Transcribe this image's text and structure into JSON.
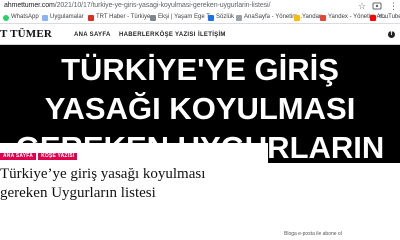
{
  "browser": {
    "url_host": "ahmettumer.com",
    "url_path": "/2021/10/17/turkiye-ye-giris-yasagi-koyulmasi-gereken-uygurlarin-listesi/",
    "bookmarks": [
      {
        "label": "WhatsApp",
        "color": "#25d366"
      },
      {
        "label": "Uygulamalar",
        "color": "#8ab4f8"
      },
      {
        "label": "TRT Haber - Türkiye...",
        "color": "#d93025"
      },
      {
        "label": "Ekşi | Yaşam Ege T...",
        "color": "#80868b"
      },
      {
        "label": "Sözlük",
        "color": "#1a73e8"
      },
      {
        "label": "AnaSayfa - Yönetim...",
        "color": "#9aa0a6"
      },
      {
        "label": "Yandan",
        "color": "#fbbc04"
      },
      {
        "label": "Yandex - Yönetim Ar...",
        "color": "#ea4335"
      },
      {
        "label": "YouTube",
        "color": "#ff0000"
      }
    ]
  },
  "site": {
    "logo": "T TÜMER",
    "nav": [
      "ANA SAYFA",
      "HABERLER",
      "KÖŞE YAZISI",
      "İLETİŞİM"
    ],
    "social_icon": "f"
  },
  "hero": {
    "lines": [
      "TÜRKİYE'YE GİRİŞ",
      "YASAĞI KOYULMASI",
      "GEREKEN UYGURLARIN"
    ]
  },
  "article": {
    "tags": [
      "ANA SAYFA",
      "KÖŞE YAZISI"
    ],
    "title_line1": "Türkiye’ye giriş yasağı koyulması",
    "title_line2": "gereken Uygurların listesi"
  },
  "sidebar": {
    "text": "Bloga e-posta ile abone ol"
  },
  "colors": {
    "accent": "#e0004d",
    "hero_bg": "#000000",
    "hero_text": "#ffffff"
  }
}
